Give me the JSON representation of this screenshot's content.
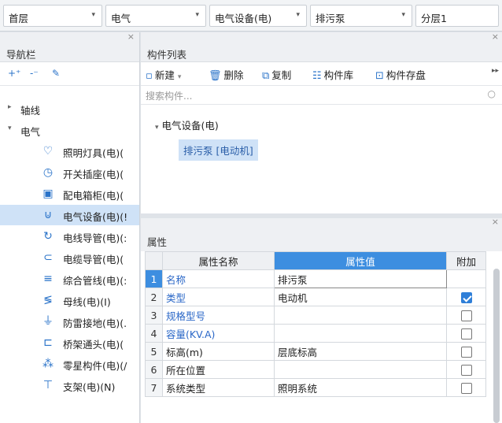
{
  "topbar": {
    "floor": "首层",
    "discipline": "电气",
    "category": "电气设备(电)",
    "component": "排污泵",
    "layer": "分层1"
  },
  "nav": {
    "close": "×",
    "title": "导航栏",
    "tools": [
      "+⁺",
      "-⁻",
      "✎"
    ],
    "tree": [
      {
        "label": "轴线",
        "arrow": "▸"
      },
      {
        "label": "电气",
        "arrow": "▾"
      },
      {
        "label": "照明灯具(电)(",
        "icon": "bulb-icon",
        "glyph": "♡"
      },
      {
        "label": "开关插座(电)(",
        "icon": "switch-icon",
        "glyph": "◷"
      },
      {
        "label": "配电箱柜(电)(",
        "icon": "panel-icon",
        "glyph": "▣"
      },
      {
        "label": "电气设备(电)(!",
        "icon": "plug-icon",
        "glyph": "⊍"
      },
      {
        "label": "电线导管(电)(:",
        "icon": "wire-conduit-icon",
        "glyph": "↻"
      },
      {
        "label": "电缆导管(电)(",
        "icon": "cable-conduit-icon",
        "glyph": "⊂"
      },
      {
        "label": "综合管线(电)(:",
        "icon": "pipeline-icon",
        "glyph": "≡"
      },
      {
        "label": "母线(电)(I)",
        "icon": "busbar-icon",
        "glyph": "≶"
      },
      {
        "label": "防雷接地(电)(.",
        "icon": "grounding-icon",
        "glyph": "⏚"
      },
      {
        "label": "桥架通头(电)(",
        "icon": "bridge-fitting-icon",
        "glyph": "⊏"
      },
      {
        "label": "零星构件(电)(/",
        "icon": "misc-component-icon",
        "glyph": "⁂"
      },
      {
        "label": "支架(电)(N)",
        "icon": "bracket-icon",
        "glyph": "⊤"
      }
    ]
  },
  "complist": {
    "close": "×",
    "title": "构件列表",
    "toolbar": {
      "new": "新建",
      "delete": "删除",
      "copy": "复制",
      "library": "构件库",
      "save": "构件存盘",
      "more": "▸▸"
    },
    "search_placeholder": "搜索构件...",
    "group": "电气设备(电)",
    "item": "排污泵 [电动机]"
  },
  "props": {
    "close": "×",
    "title": "属性",
    "headers": [
      "属性名称",
      "属性值",
      "附加"
    ],
    "rows": [
      {
        "num": "1",
        "name": "名称",
        "value": "排污泵",
        "blue": true,
        "check": null
      },
      {
        "num": "2",
        "name": "类型",
        "value": "电动机",
        "blue": true,
        "check": true
      },
      {
        "num": "3",
        "name": "规格型号",
        "value": "",
        "blue": true,
        "check": false
      },
      {
        "num": "4",
        "name": "容量(KV.A)",
        "value": "",
        "blue": true,
        "check": false
      },
      {
        "num": "5",
        "name": "标高(m)",
        "value": "层底标高",
        "blue": false,
        "check": false
      },
      {
        "num": "6",
        "name": "所在位置",
        "value": "",
        "blue": false,
        "check": false
      },
      {
        "num": "7",
        "name": "系统类型",
        "value": "照明系统",
        "blue": false,
        "check": false
      }
    ]
  },
  "colors": {
    "accent": "#3d8ee0",
    "link_blue": "#2a67c7",
    "selection": "#cfe2f7"
  }
}
